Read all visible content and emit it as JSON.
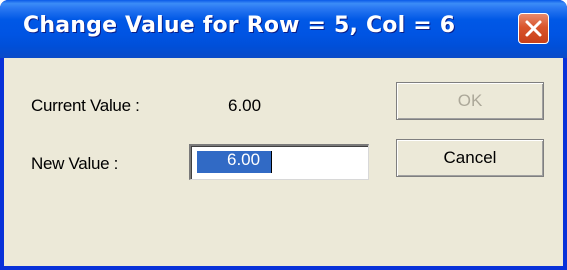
{
  "window": {
    "title": "Change Value for Row = 5, Col = 6",
    "close_icon": "close-x-icon"
  },
  "form": {
    "current_value_label": "Current Value :",
    "current_value": "6.00",
    "new_value_label": "New Value :",
    "new_value": "6.00"
  },
  "buttons": {
    "ok_label": "OK",
    "cancel_label": "Cancel"
  },
  "colors": {
    "titlebar": "#0054e3",
    "dialog_bg": "#ece9d8",
    "selection": "#316ac5",
    "close_button": "#d9552c",
    "disabled_text": "#aca899"
  }
}
